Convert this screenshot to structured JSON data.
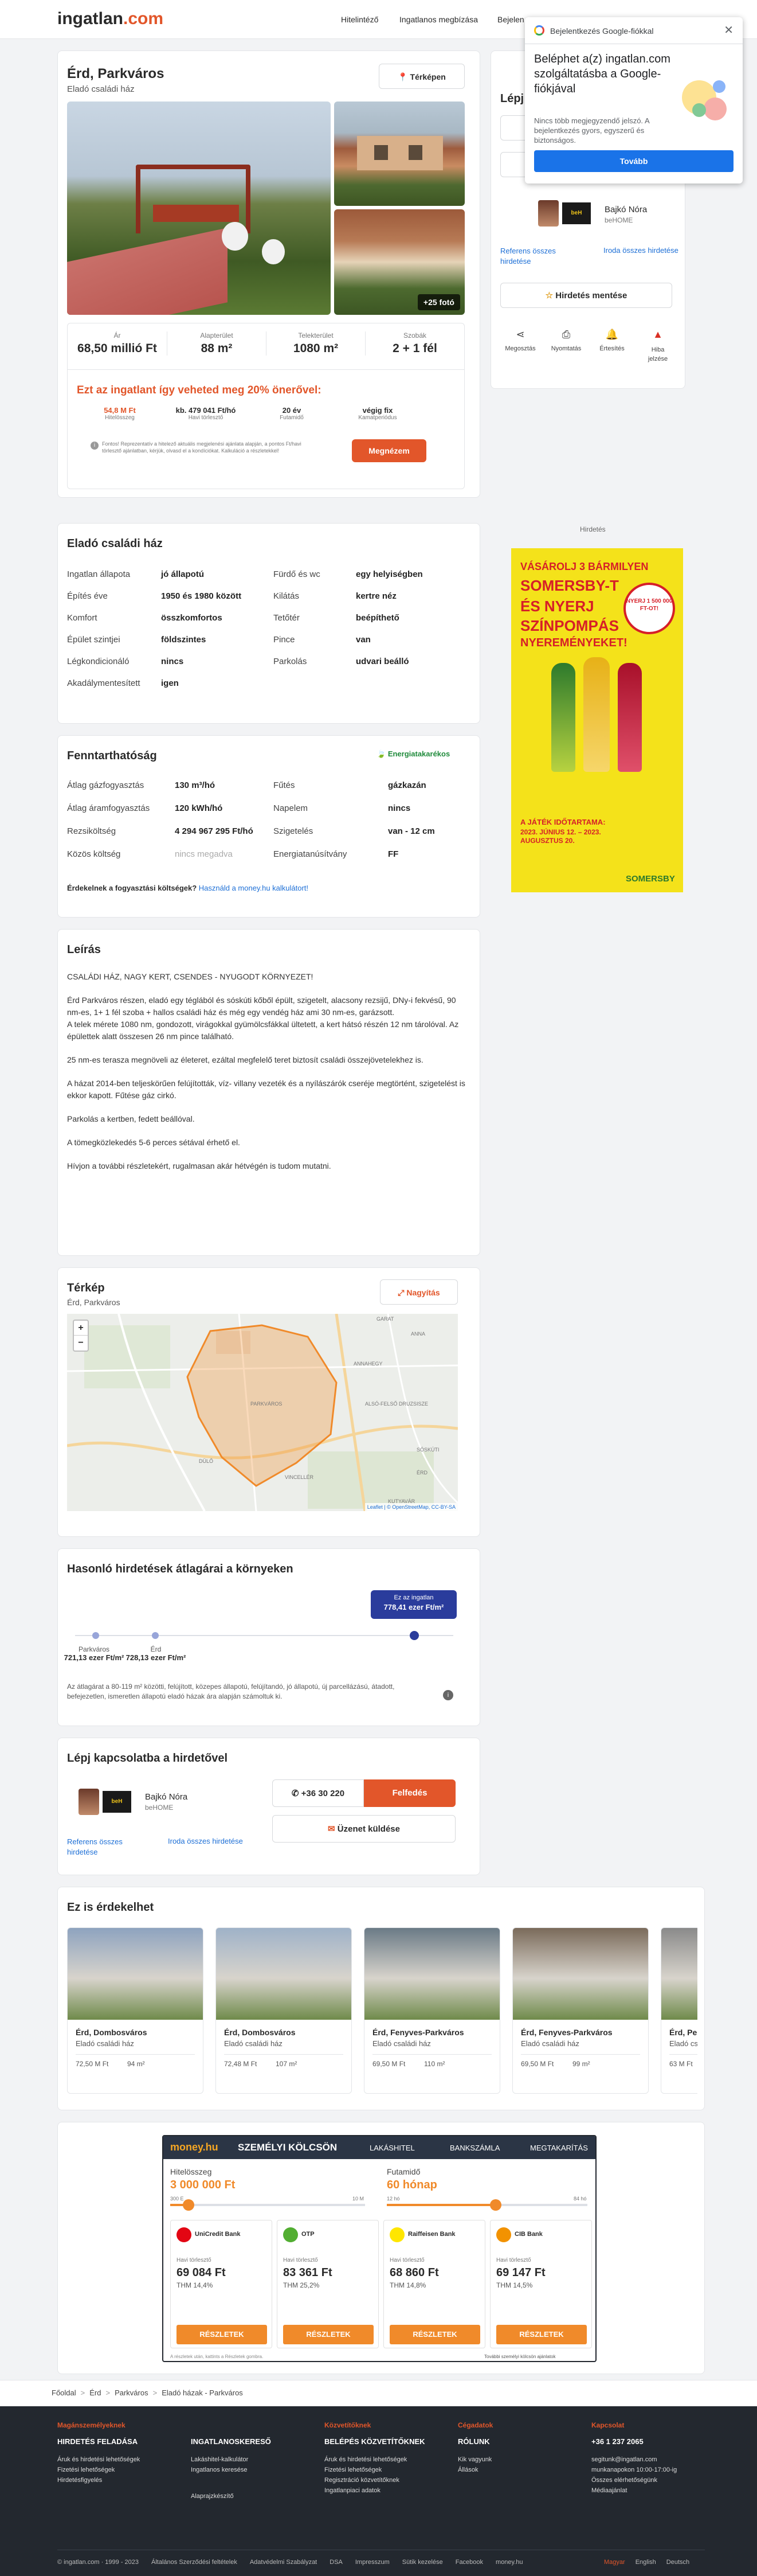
{
  "header": {
    "logo_main": "ingatlan",
    "logo_tld": ".com",
    "nav": [
      "Hitelintéző",
      "Ingatlanos megbízása",
      "Bejelen"
    ]
  },
  "google_popup": {
    "title": "Bejelentkezés Google-fiókkal",
    "heading": "Beléphet a(z) ingatlan.com szolgáltatásba a Google-fiókjával",
    "body": "Nincs több megjegyzendő jelszó. A bejelentkezés gyors, egyszerű és biztonságos.",
    "button": "Tovább"
  },
  "listing": {
    "title": "Érd, Parkváros",
    "subtitle": "Eladó családi ház",
    "map_button": "Térképen",
    "photos_badge": "+25 fotó",
    "stats": [
      {
        "label": "Ár",
        "value": "68,50 millió Ft"
      },
      {
        "label": "Alapterület",
        "value": "88 m²"
      },
      {
        "label": "Telekterület",
        "value": "1080 m²"
      },
      {
        "label": "Szobák",
        "value": "2 + 1 fél"
      }
    ],
    "loan_banner": {
      "title": "Ezt az ingatlant így veheted meg 20% önerővel:",
      "items": [
        {
          "value": "54,8 M Ft",
          "label": "Hitelösszeg"
        },
        {
          "value": "kb. 479 041 Ft/hó",
          "label": "Havi törlesztő"
        },
        {
          "value": "20 év",
          "label": "Futamidő"
        },
        {
          "value": "végig fix",
          "label": "Kamatperiódus"
        }
      ],
      "disclaimer": "Fontos! Reprezentatív a hitelező aktuális megjelenési ajánlata alapján, a pontos Ft/havi törlesztő ajánlatban, kérjük, olvasd el a kondíciókat. Kalkuláció a részletekkel!",
      "button": "Megnézem"
    }
  },
  "sidebar": {
    "heading": "Lépj",
    "agent_name": "Bajkó Nóra",
    "agent_company": "beHOME",
    "ref_link": "Referens összes hirdetése",
    "office_link": "Iroda összes hirdetése",
    "save_button": "Hirdetés mentése",
    "actions": [
      "Megosztás",
      "Nyomtatás",
      "Értesítés",
      "Hiba jelzése"
    ]
  },
  "ad": {
    "label": "Hirdetés",
    "headline1": "VÁSÁROLJ 3 BÁRMILYEN",
    "headline2": "SOMERSBY-T",
    "headline3": "ÉS NYERJ",
    "headline4": "SZÍNPOMPÁS",
    "headline5": "NYEREMÉNYEKET!",
    "prize": "NYERJ 1 500 000 FT-OT!",
    "footer1": "A JÁTÉK IDŐTARTAMA:",
    "footer2": "2023. JÚNIUS 12. – 2023. AUGUSZTUS 20.",
    "brand": "SOMERSBY"
  },
  "details": {
    "title": "Eladó családi ház",
    "rows": [
      [
        "Ingatlan állapota",
        "jó állapotú",
        "Fürdő és wc",
        "egy helyiségben"
      ],
      [
        "Építés éve",
        "1950 és 1980 között",
        "Kilátás",
        "kertre néz"
      ],
      [
        "Komfort",
        "összkomfortos",
        "Tetőtér",
        "beépíthető"
      ],
      [
        "Épület szintjei",
        "földszintes",
        "Pince",
        "van"
      ],
      [
        "Légkondicionáló",
        "nincs",
        "Parkolás",
        "udvari beálló"
      ],
      [
        "Akadálymentesített",
        "igen",
        "",
        ""
      ]
    ]
  },
  "energy": {
    "title": "Fenntarthatóság",
    "badge": "Energiatakarékos",
    "rows": [
      [
        "Átlag gázfogyasztás",
        "130 m³/hó",
        "Fűtés",
        "gázkazán"
      ],
      [
        "Átlag áramfogyasztás",
        "120 kWh/hó",
        "Napelem",
        "nincs"
      ],
      [
        "Rezsiköltség",
        "4 294 967 295 Ft/hó",
        "Szigetelés",
        "van - 12 cm"
      ],
      [
        "Közös költség",
        "nincs megadva",
        "Energiatanúsítvány",
        "FF"
      ]
    ],
    "note": "Érdekelnek a fogyasztási költségek?",
    "note_link": "Használd a money.hu kalkulátort!"
  },
  "description": {
    "title": "Leírás",
    "paragraphs": [
      "CSALÁDI HÁZ, NAGY KERT, CSENDES - NYUGODT KÖRNYEZET!",
      "Érd Parkváros részen, eladó egy téglából és sóskúti kőből épült, szigetelt, alacsony rezsijű, DNy-i fekvésű, 90 nm-es, 1+ 1 fél szoba + hallos családi ház és még egy vendég ház ami 30 nm-es, garázsott.\nA telek mérete 1080 nm, gondozott, virágokkal gyümölcsfákkal ültetett, a kert hátsó részén 12 nm tárolóval. Az épülettek alatt összesen 26 nm pince található.",
      "25 nm-es terasza megnöveli az életeret, ezáltal megfelelő teret biztosít családi összejövetelekhez is.",
      "A házat 2014-ben teljeskörűen felújították, víz- villany vezeték és a nyílászárók cseréje megtörtént, szigetelést is ekkor kapott. Fűtése gáz cirkó.",
      "Parkolás a kertben, fedett beállóval.",
      "A tömegközlekedés 5-6 perces sétával érhető el.",
      "Hívjon a további részletekért, rugalmasan akár hétvégén is tudom mutatni."
    ]
  },
  "map": {
    "title": "Térkép",
    "subtitle": "Érd, Parkváros",
    "expand": "Nagyítás",
    "attribution": "Leaflet | © OpenStreetMap, CC-BY-SA",
    "places": [
      "GARAT",
      "ANNA",
      "ANNAHEGY",
      "ALSÓ-FELSŐ DRUZSISZE",
      "PARKVÁROS",
      "DÜLŐ",
      "VINCELLÉR",
      "SÓSKÚTI",
      "KUTYAVÁR",
      "ÉRD"
    ]
  },
  "similar_price": {
    "title": "Hasonló hirdetések átlagárai a környeken",
    "bubble_label": "Ez az ingatlan",
    "bubble_value": "778,41 ezer Ft/m²",
    "points": [
      {
        "name": "Parkváros",
        "value": "721,13 ezer Ft/m²"
      },
      {
        "name": "Érd",
        "value": "728,13 ezer Ft/m²"
      }
    ],
    "note": "Az átlagárat a 80-119 m² közötti, felújított, közepes állapotú, felújítandó, jó állapotú, új parcellázású, átadott, befejezetlen, ismeretlen állapotú eladó házak ára alapján számoltuk ki."
  },
  "contact": {
    "title": "Lépj kapcsolatba a hirdetővel",
    "phone": "+36 30 220",
    "reveal": "Felfedés",
    "message": "Üzenet küldése"
  },
  "recommend": {
    "title": "Ez is érdekelhet",
    "cards": [
      {
        "title": "Érd, Dombosváros",
        "type": "Eladó családi ház",
        "price": "72,50 M Ft",
        "area": "94 m²"
      },
      {
        "title": "Érd, Dombosváros",
        "type": "Eladó családi ház",
        "price": "72,48 M Ft",
        "area": "107 m²"
      },
      {
        "title": "Érd, Fenyves-Parkváros",
        "type": "Eladó családi ház",
        "price": "69,50 M Ft",
        "area": "110 m²"
      },
      {
        "title": "Érd, Fenyves-Parkváros",
        "type": "Eladó családi ház",
        "price": "69,50 M Ft",
        "area": "99 m²"
      },
      {
        "title": "Érd, Pes",
        "type": "Eladó csa",
        "price": "63 M Ft",
        "area": ""
      }
    ]
  },
  "money": {
    "brand": "money.hu",
    "product": "SZEMÉLYI KÖLCSÖN",
    "tabs": [
      "LAKÁSHITEL",
      "BANKSZÁMLA",
      "MEGTAKARÍTÁS"
    ],
    "loan_label": "Hitelösszeg",
    "loan_value": "3 000 000 Ft",
    "term_label": "Futamidő",
    "term_value": "60 hónap",
    "scale_loan": [
      "300 E",
      "10 M"
    ],
    "scale_term": [
      "12 hó",
      "84 hó"
    ],
    "banks": [
      {
        "name": "UniCredit Bank",
        "label": "Havi törlesztő",
        "amount": "69 084 Ft",
        "thm": "THM 14,4%",
        "color": "#e30613"
      },
      {
        "name": "OTP",
        "label": "Havi törlesztő",
        "amount": "83 361 Ft",
        "thm": "THM 25,2%",
        "color": "#52ae32"
      },
      {
        "name": "Raiffeisen Bank",
        "label": "Havi törlesztő",
        "amount": "68 860 Ft",
        "thm": "THM 14,8%",
        "color": "#ffe600"
      },
      {
        "name": "CIB Bank",
        "label": "Havi törlesztő",
        "amount": "69 147 Ft",
        "thm": "THM 14,5%",
        "color": "#f29200"
      }
    ],
    "cta": "RÉSZLETEK",
    "footnote_left": "A részletek után, kattints a Részletek gombra.",
    "footnote_right": "További személyi kölcsön ajánlatok"
  },
  "breadcrumb": [
    "Főoldal",
    "Érd",
    "Parkváros",
    "Eladó házak - Parkváros"
  ],
  "footer": {
    "cols": [
      {
        "cat": "Magánszemélyeknek",
        "head": "HIRDETÉS FELADÁSA",
        "links": [
          "Áruk és hirdetési lehetőségek",
          "Fizetési lehetőségek",
          "Hirdetésfigyelés"
        ]
      },
      {
        "cat": "",
        "head": "INGATLANOSKERESŐ",
        "links": [
          "Lakáshitel-kalkulátor",
          "Ingatlanos keresése",
          "Alaprajzkészítő"
        ]
      },
      {
        "cat": "Közvetítőknek",
        "head": "BELÉPÉS KÖZVETÍTŐKNEK",
        "links": [
          "Áruk és hirdetési lehetőségek",
          "Fizetési lehetőségek",
          "Regisztráció közvetítőknek",
          "Ingatlanpiaci adatok"
        ]
      },
      {
        "cat": "Cégadatok",
        "head": "RÓLUNK",
        "links": [
          "Kik vagyunk",
          "Állások"
        ]
      },
      {
        "cat": "Kapcsolat",
        "head": "+36 1 237 2065",
        "links": [
          "segitunk@ingatlan.com",
          "munkanapokon 10:00-17:00-ig",
          "Összes elérhetőségünk",
          "Médiaajánlat"
        ]
      }
    ],
    "bottom": [
      "© ingatlan.com · 1999 - 2023",
      "Általános Szerződési feltételek",
      "Adatvédelmi Szabályzat",
      "DSA",
      "Impresszum",
      "Sütik kezelése",
      "Facebook",
      "money.hu"
    ],
    "langs": [
      "Magyar",
      "English",
      "Deutsch"
    ]
  },
  "colors": {
    "accent": "#e2562a",
    "brand_blue": "#1d6fd6",
    "navy": "#23282f",
    "green": "#1e8a3a"
  }
}
